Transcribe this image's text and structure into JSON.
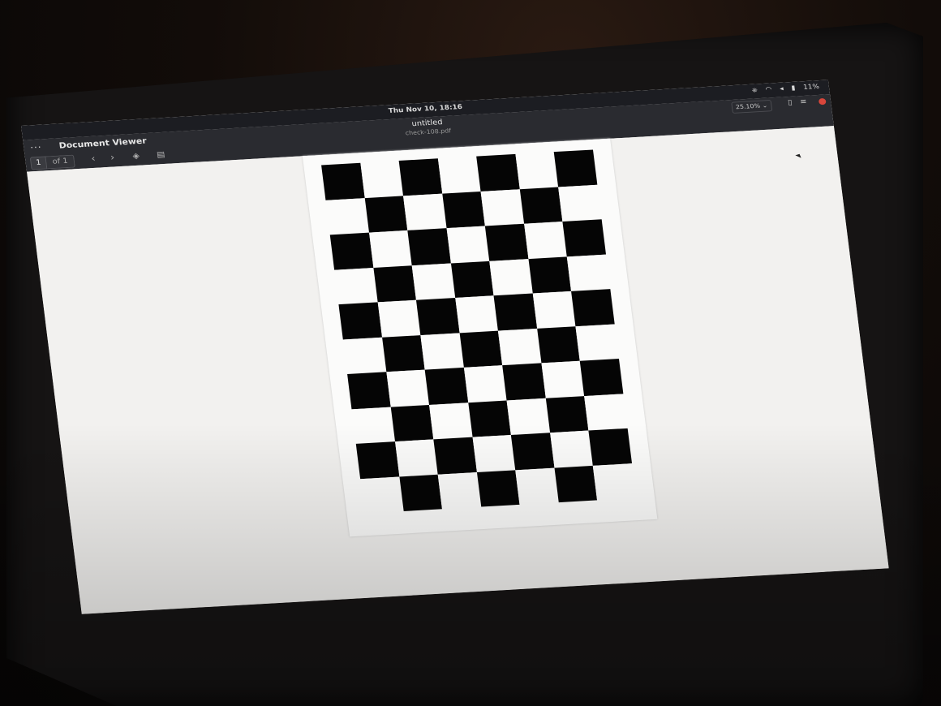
{
  "system": {
    "clock": "Thu Nov 10, 18:16",
    "tray": [
      "network-icon",
      "wifi-icon",
      "volume-icon",
      "battery-icon"
    ],
    "battery": "11%"
  },
  "window": {
    "app_title": "Document Viewer",
    "doc_title": "untitled",
    "doc_file": "check-108.pdf",
    "zoom": "25.10%",
    "page_current": "1",
    "page_total": "of 1"
  },
  "icons": {
    "menu": "menu-dots-icon",
    "prev": "chevron-left-icon",
    "next": "chevron-right-icon",
    "annotate": "annotate-icon",
    "sidebar": "sidebar-icon",
    "bookmark": "bookmark-icon",
    "options": "hamburger-icon",
    "close": "close-icon"
  },
  "colors": {
    "headerbar": "#2a2b30",
    "topbar": "#1c1d22",
    "canvas": "#f2f1ef",
    "close": "#d9463b"
  },
  "document": {
    "pattern": "checkerboard",
    "columns": 7,
    "rows": 10
  }
}
